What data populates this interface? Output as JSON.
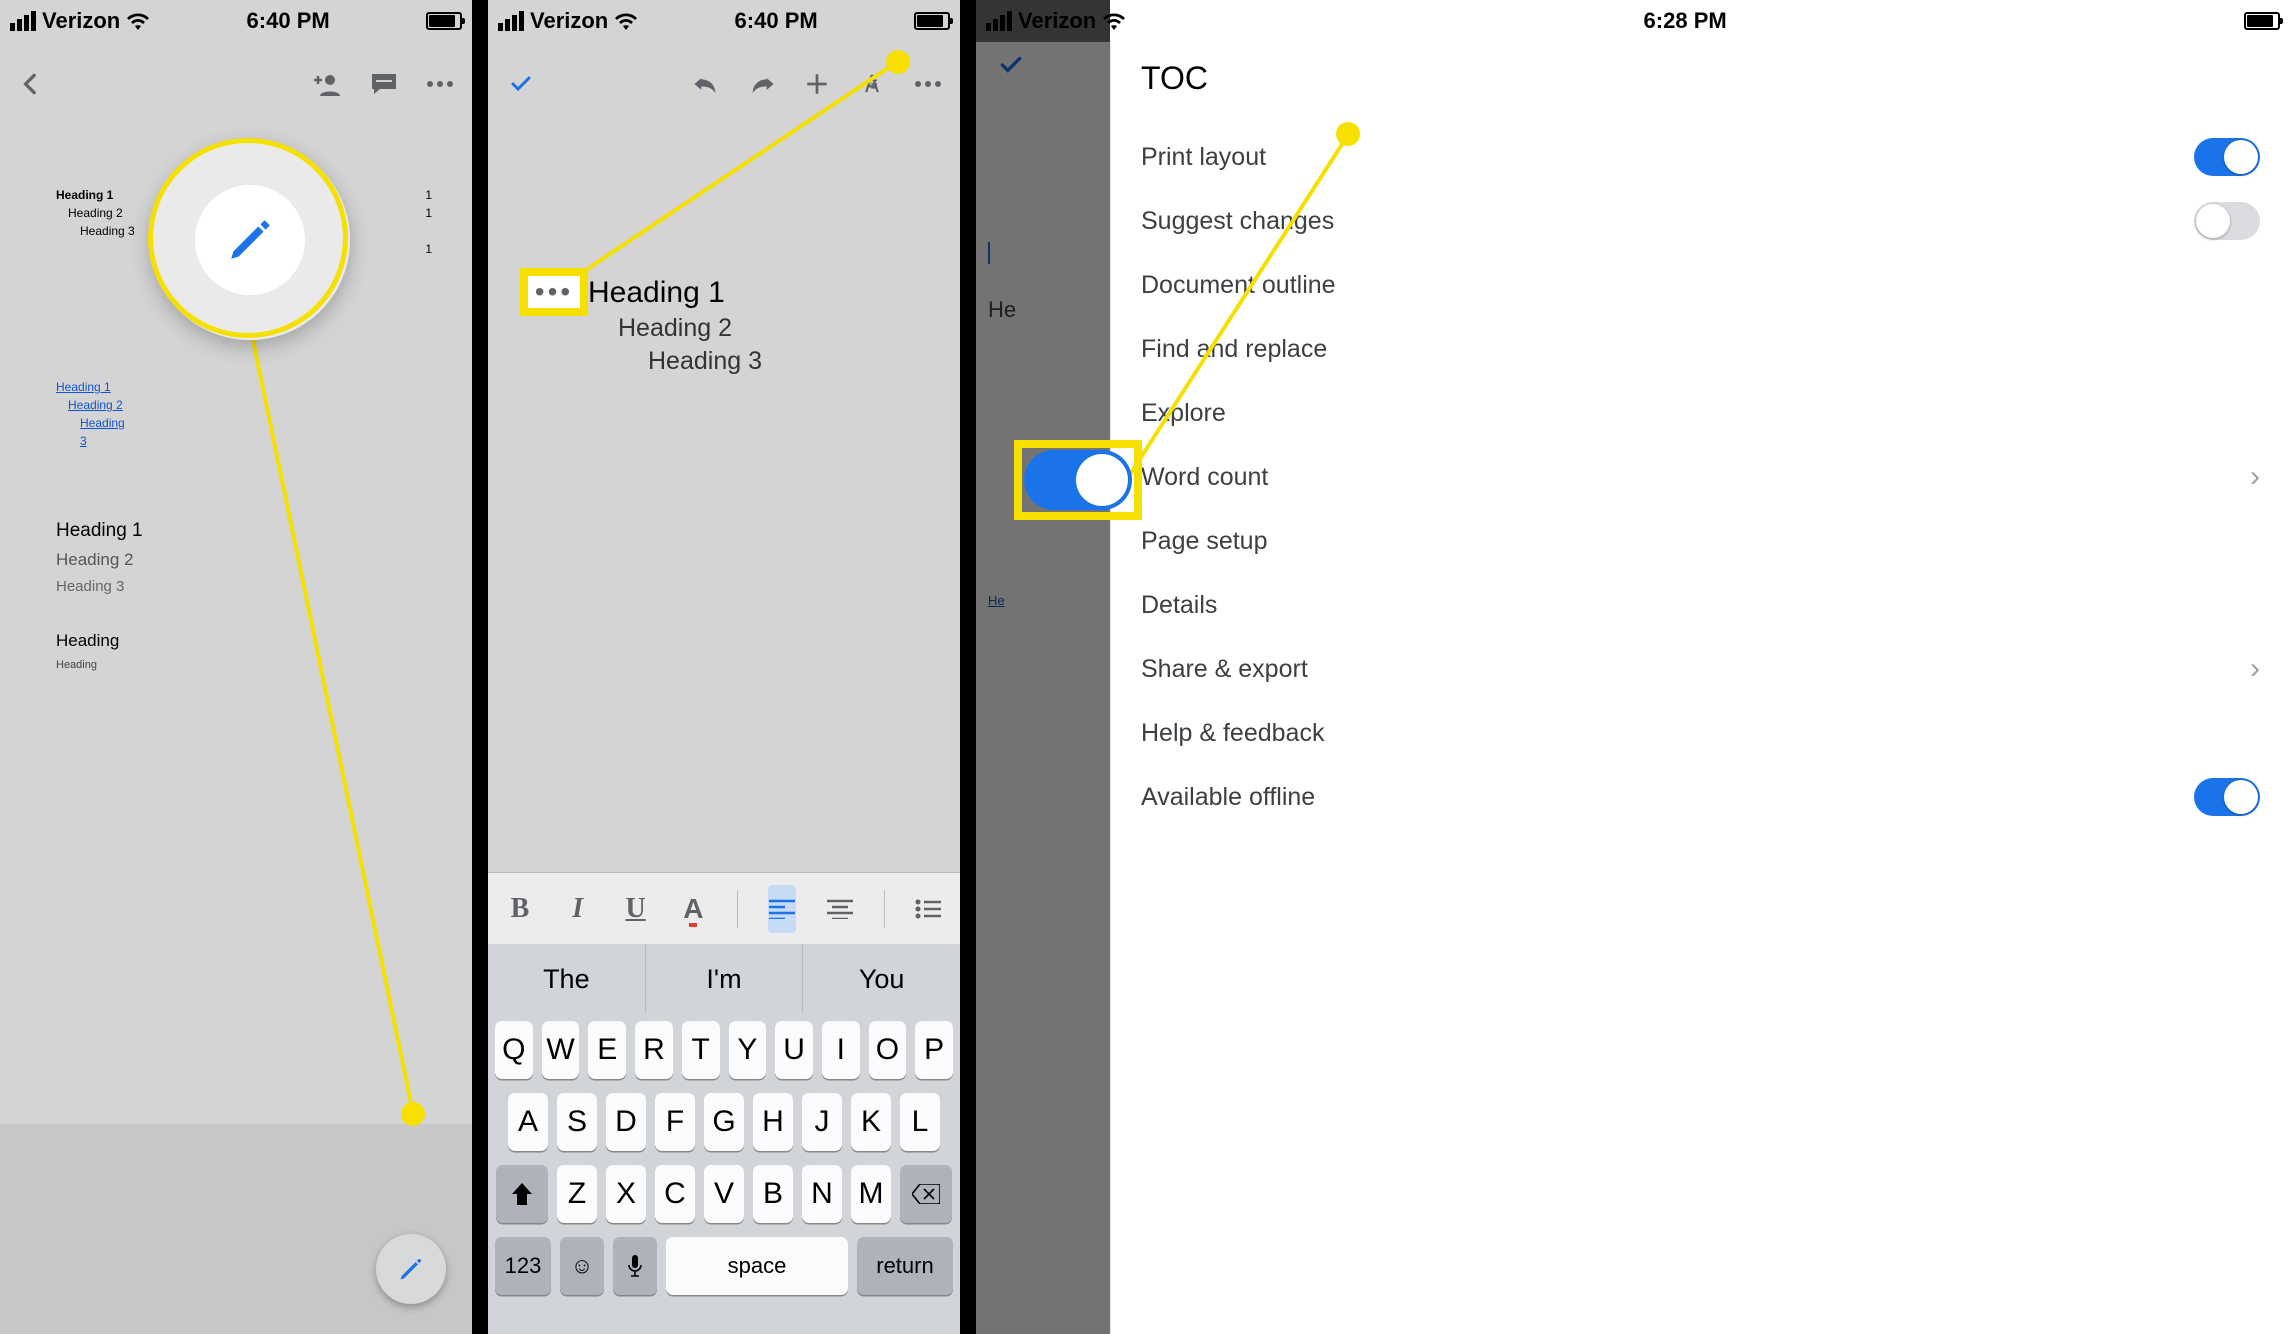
{
  "status": {
    "carrier": "Verizon",
    "time1": "6:40 PM",
    "time3": "6:28 PM"
  },
  "s1": {
    "toc": {
      "h1": "Heading 1",
      "h2": "Heading 2",
      "h3": "Heading 3",
      "p": "1"
    },
    "links": {
      "h1": "Heading 1",
      "h2": "Heading 2",
      "h3": "Heading",
      "h3b": "3"
    },
    "body": {
      "h1": "Heading 1",
      "h2": "Heading 2",
      "h3": "Heading 3",
      "hh": "Heading",
      "hsub": "Heading"
    }
  },
  "s2": {
    "body": {
      "h1": "Heading 1",
      "h2": "Heading 2",
      "h3": "Heading 3"
    },
    "sug": [
      "The",
      "I'm",
      "You"
    ],
    "rows": [
      [
        "Q",
        "W",
        "E",
        "R",
        "T",
        "Y",
        "U",
        "I",
        "O",
        "P"
      ],
      [
        "A",
        "S",
        "D",
        "F",
        "G",
        "H",
        "J",
        "K",
        "L"
      ],
      [
        "Z",
        "X",
        "C",
        "V",
        "B",
        "N",
        "M"
      ]
    ],
    "bot": {
      "num": "123",
      "space": "space",
      "ret": "return"
    },
    "dots": "•••"
  },
  "s3": {
    "title": "TOC",
    "doc": {
      "he": "He",
      "he2": "He"
    },
    "items": [
      {
        "label": "Print layout",
        "type": "toggle",
        "on": true
      },
      {
        "label": "Suggest changes",
        "type": "toggle",
        "on": false
      },
      {
        "label": "Document outline",
        "type": "link"
      },
      {
        "label": "Find and replace",
        "type": "link"
      },
      {
        "label": "Explore",
        "type": "link"
      },
      {
        "label": "Word count",
        "type": "chev"
      },
      {
        "label": "Page setup",
        "type": "link"
      },
      {
        "label": "Details",
        "type": "link"
      },
      {
        "label": "Share & export",
        "type": "chev"
      },
      {
        "label": "Help & feedback",
        "type": "link"
      },
      {
        "label": "Available offline",
        "type": "toggle",
        "on": true
      }
    ]
  }
}
